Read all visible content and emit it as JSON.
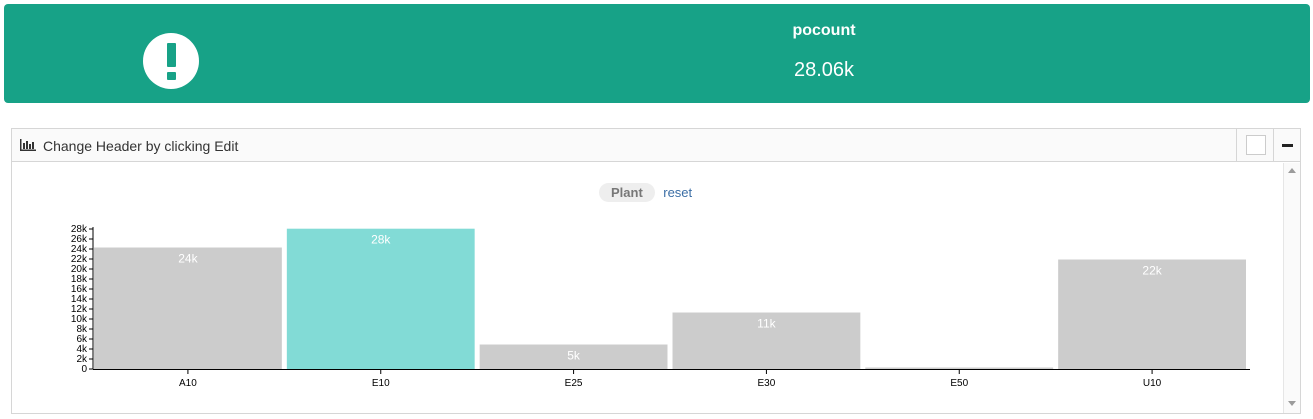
{
  "kpi": {
    "label": "pocount",
    "value": "28.06k",
    "icon": "exclamation-icon",
    "background_color": "#17a287"
  },
  "panel": {
    "title": "Change Header by clicking Edit",
    "icon": "bar-chart-icon",
    "filter_label": "Plant",
    "reset_label": "reset"
  },
  "chart_data": {
    "type": "bar",
    "categories": [
      "A10",
      "E10",
      "E25",
      "E30",
      "E50",
      "U10"
    ],
    "values": [
      24300,
      28060,
      4900,
      11300,
      300,
      21900
    ],
    "data_labels": [
      "24k",
      "28k",
      "5k",
      "11k",
      "",
      "22k"
    ],
    "selected": "E10",
    "colors": {
      "default": "#cccccc",
      "selected": "#82dbd6"
    },
    "ylim": [
      0,
      28000
    ],
    "yticks": [
      0,
      2000,
      4000,
      6000,
      8000,
      10000,
      12000,
      14000,
      16000,
      18000,
      20000,
      22000,
      24000,
      26000,
      28000
    ],
    "ytick_labels": [
      "0",
      "2k",
      "4k",
      "6k",
      "8k",
      "10k",
      "12k",
      "14k",
      "16k",
      "18k",
      "20k",
      "22k",
      "24k",
      "26k",
      "28k"
    ],
    "grid": false
  }
}
